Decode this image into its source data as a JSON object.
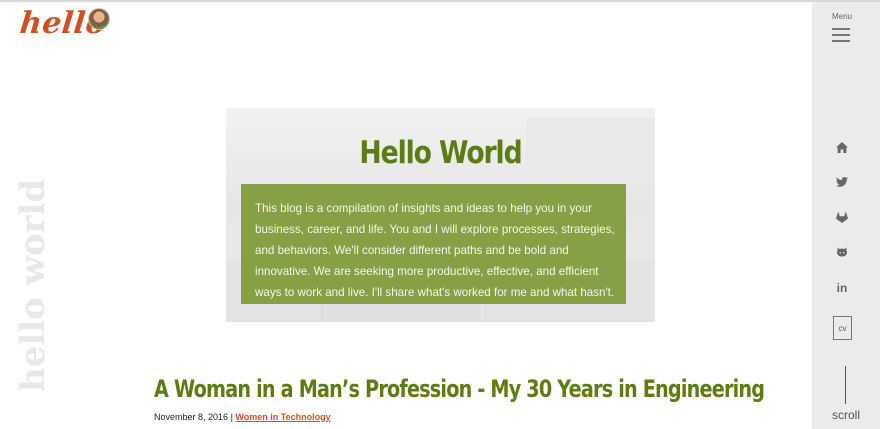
{
  "logo": {
    "text": "hello"
  },
  "watermark": {
    "text": "hello world"
  },
  "sidebar": {
    "menu_label": "Menu",
    "icons": [
      "home-icon",
      "twitter-icon",
      "gitlab-icon",
      "github-icon",
      "linkedin-icon"
    ],
    "linkedin_text": "in",
    "cv_label": "cv",
    "scroll_label": "scroll"
  },
  "hero": {
    "title": "Hello World",
    "body": "This blog is a compilation of insights and ideas to help you in your business, career, and life. You and I will explore processes, strategies, and behaviors. We'll consider different paths and be bold and innovative. We are seeking more productive, effective, and efficient ways to work and live. I'll share what's worked for me and what hasn't."
  },
  "post": {
    "title": "A Woman in a Man’s Profession - My 30 Years in Engineering",
    "date": "November 8, 2016",
    "separator": "|",
    "category": "Women in Technology"
  },
  "colors": {
    "accent_orange": "#d2501f",
    "title_green": "#5d7c12",
    "box_green": "#86a045",
    "sidebar_bg": "#ebebeb"
  }
}
